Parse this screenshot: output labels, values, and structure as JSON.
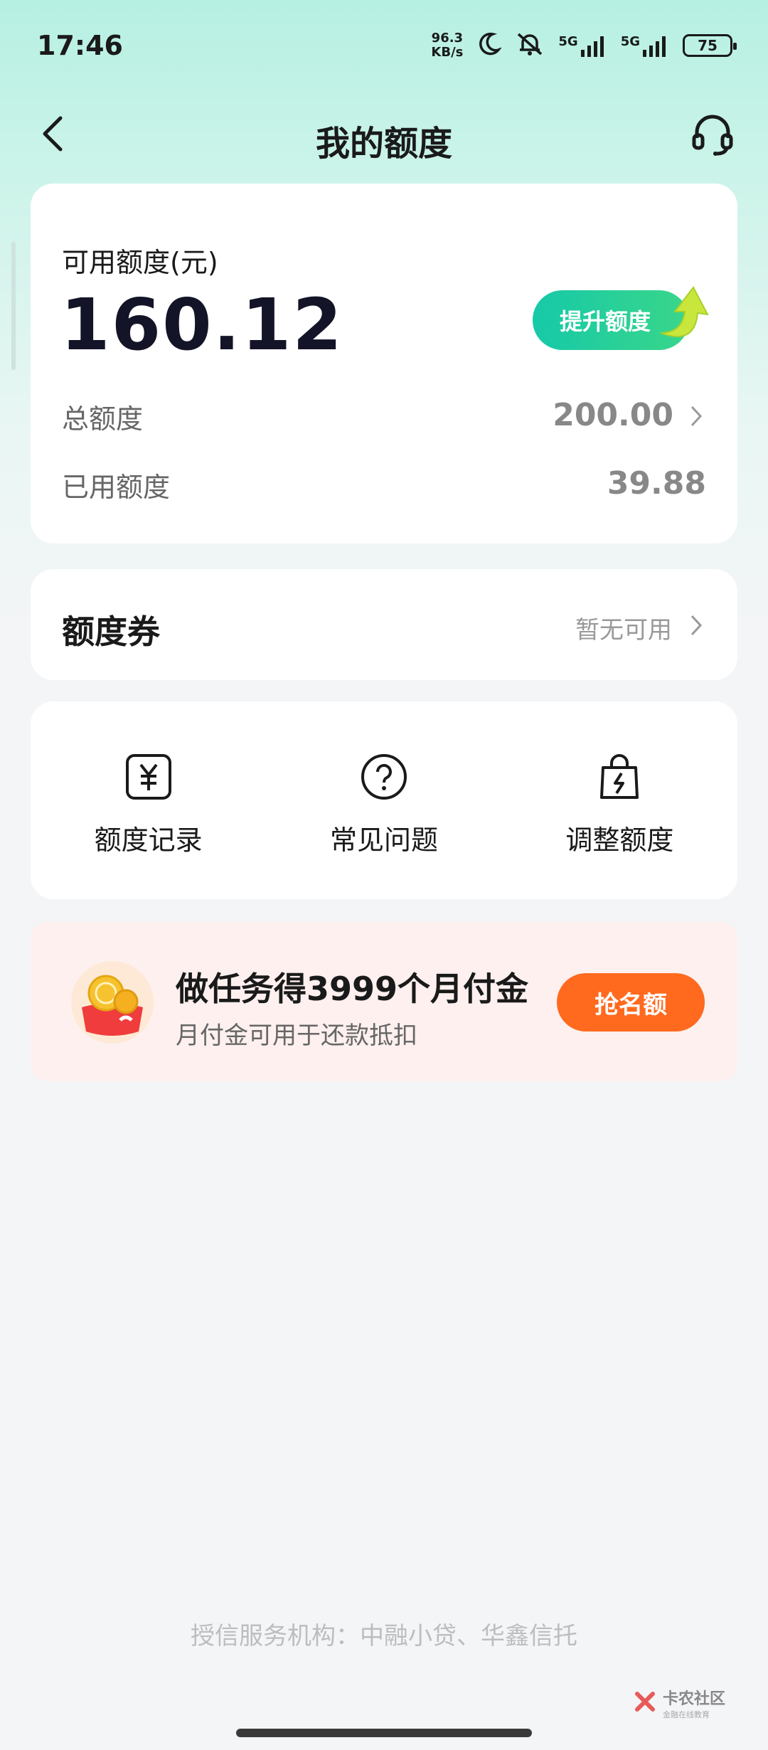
{
  "status_bar": {
    "time": "17:46",
    "net_speed_value": "96.3",
    "net_speed_unit": "KB/s",
    "signal_1_label": "5G",
    "signal_2_label": "5G",
    "battery": "75",
    "icons": [
      "moon-icon",
      "mute-icon",
      "signal-icon",
      "battery-icon"
    ]
  },
  "header": {
    "title": "我的额度",
    "back_icon": "chevron-left-icon",
    "support_icon": "headset-icon"
  },
  "credit": {
    "available_label": "可用额度(元)",
    "available_amount": "160.12",
    "raise_button": "提升额度",
    "total_label": "总额度",
    "total_value": "200.00",
    "used_label": "已用额度",
    "used_value": "39.88"
  },
  "coupon": {
    "title": "额度券",
    "status": "暂无可用"
  },
  "actions": [
    {
      "label": "额度记录",
      "icon": "yuan-record-icon"
    },
    {
      "label": "常见问题",
      "icon": "question-icon"
    },
    {
      "label": "调整额度",
      "icon": "lightning-bag-icon"
    }
  ],
  "task": {
    "title": "做任务得3999个月付金",
    "subtitle": "月付金可用于还款抵扣",
    "button": "抢名额",
    "icon": "coin-redpacket-icon"
  },
  "footer": {
    "institutions": "授信服务机构：中融小贷、华鑫信托",
    "watermark_main": "卡农社区",
    "watermark_sub": "金融在线教育"
  },
  "colors": {
    "accent_green": "#16c9a8",
    "task_orange": "#ff6a1f",
    "header_bg": "#b6f0e2"
  }
}
